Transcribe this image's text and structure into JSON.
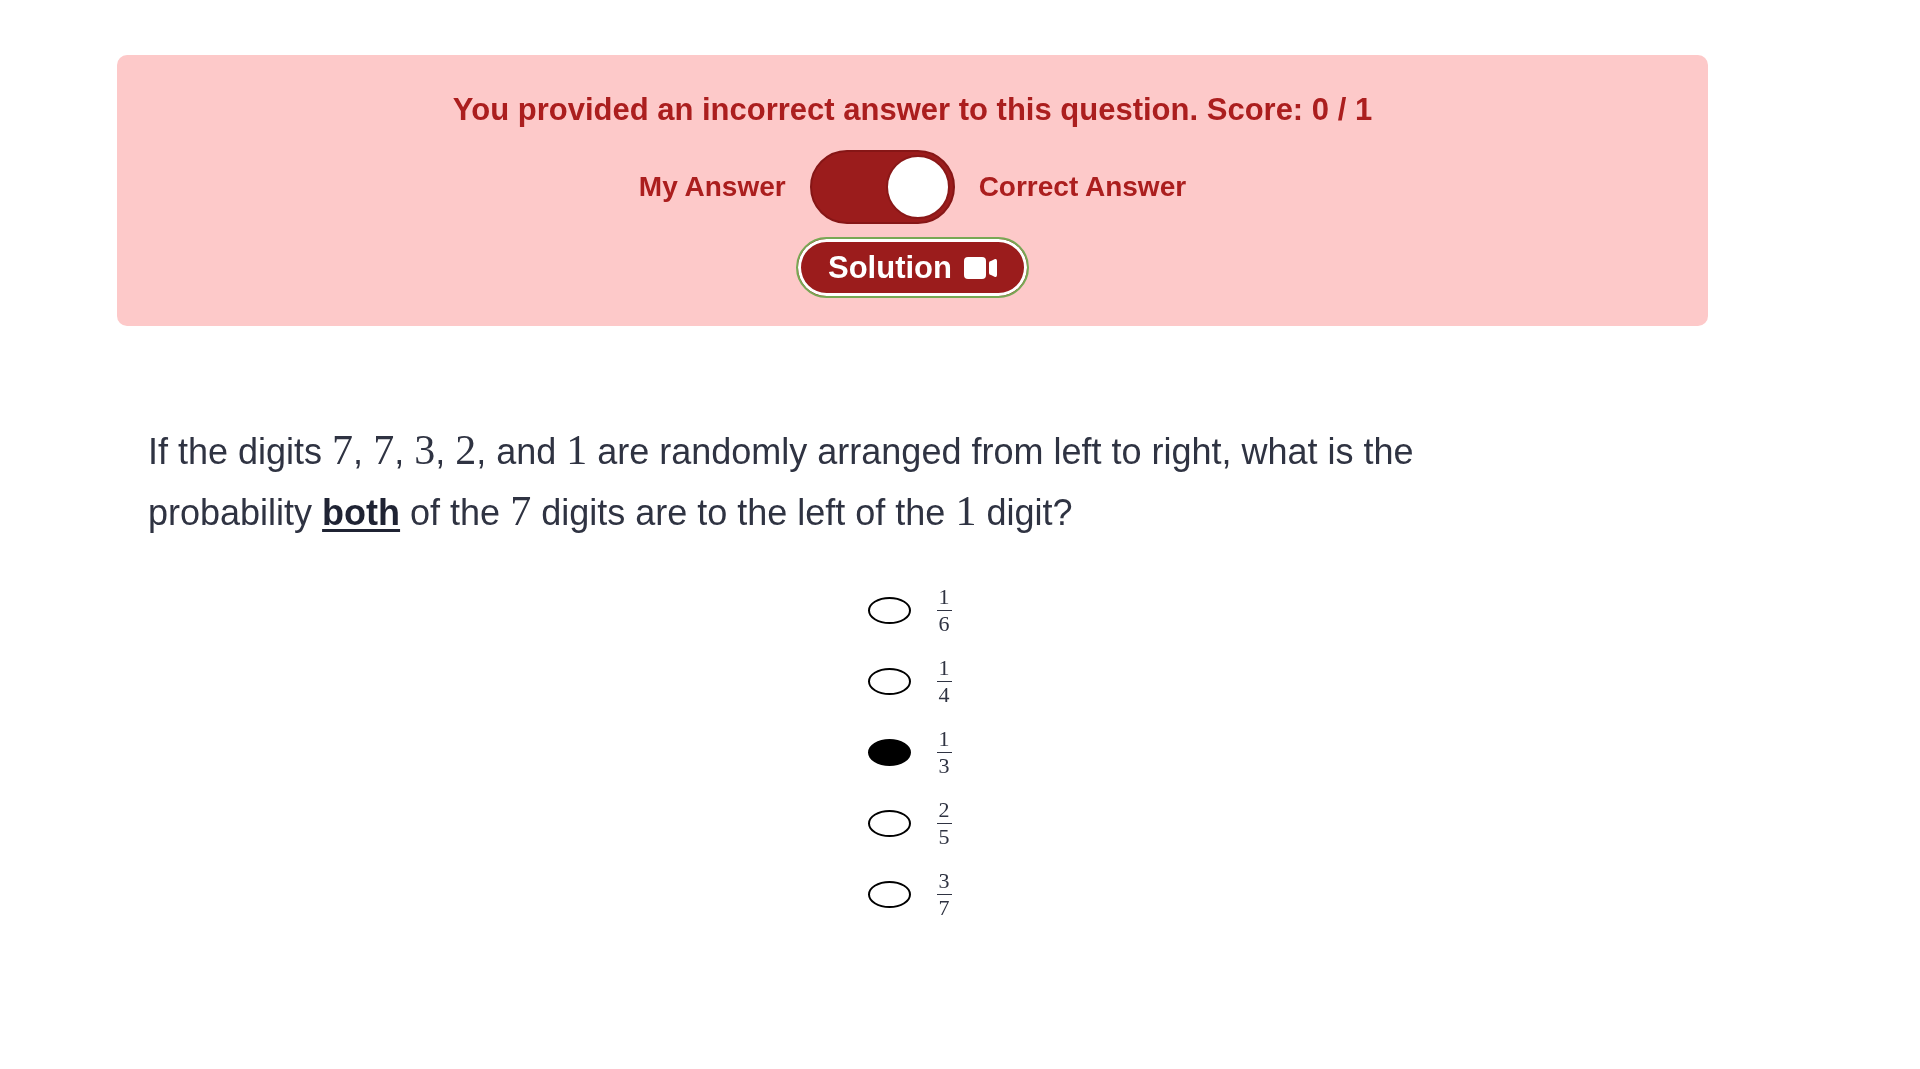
{
  "feedback": {
    "correct": false,
    "message": "You provided an incorrect answer to this question. Score: 0 / 1"
  },
  "answer_toggle": {
    "left_label": "My Answer",
    "right_label": "Correct Answer",
    "on": true
  },
  "solution_button": {
    "label": "Solution"
  },
  "question": {
    "segments": [
      {
        "kind": "text",
        "text": "If the digits "
      },
      {
        "kind": "math",
        "text": "7"
      },
      {
        "kind": "text",
        "text": ", "
      },
      {
        "kind": "math",
        "text": "7"
      },
      {
        "kind": "text",
        "text": ", "
      },
      {
        "kind": "math",
        "text": "3"
      },
      {
        "kind": "text",
        "text": ", "
      },
      {
        "kind": "math",
        "text": "2"
      },
      {
        "kind": "text",
        "text": ", and "
      },
      {
        "kind": "math",
        "text": "1"
      },
      {
        "kind": "text",
        "text": " are randomly arranged from left to right, what is the probability "
      },
      {
        "kind": "emphasis",
        "text": "both"
      },
      {
        "kind": "text",
        "text": " of the "
      },
      {
        "kind": "math",
        "text": "7"
      },
      {
        "kind": "text",
        "text": " digits are to the left of the "
      },
      {
        "kind": "math",
        "text": "1"
      },
      {
        "kind": "text",
        "text": " digit?"
      }
    ]
  },
  "choices": [
    {
      "numerator": "1",
      "denominator": "6",
      "selected": false
    },
    {
      "numerator": "1",
      "denominator": "4",
      "selected": false
    },
    {
      "numerator": "1",
      "denominator": "3",
      "selected": true
    },
    {
      "numerator": "2",
      "denominator": "5",
      "selected": false
    },
    {
      "numerator": "3",
      "denominator": "7",
      "selected": false
    }
  ]
}
